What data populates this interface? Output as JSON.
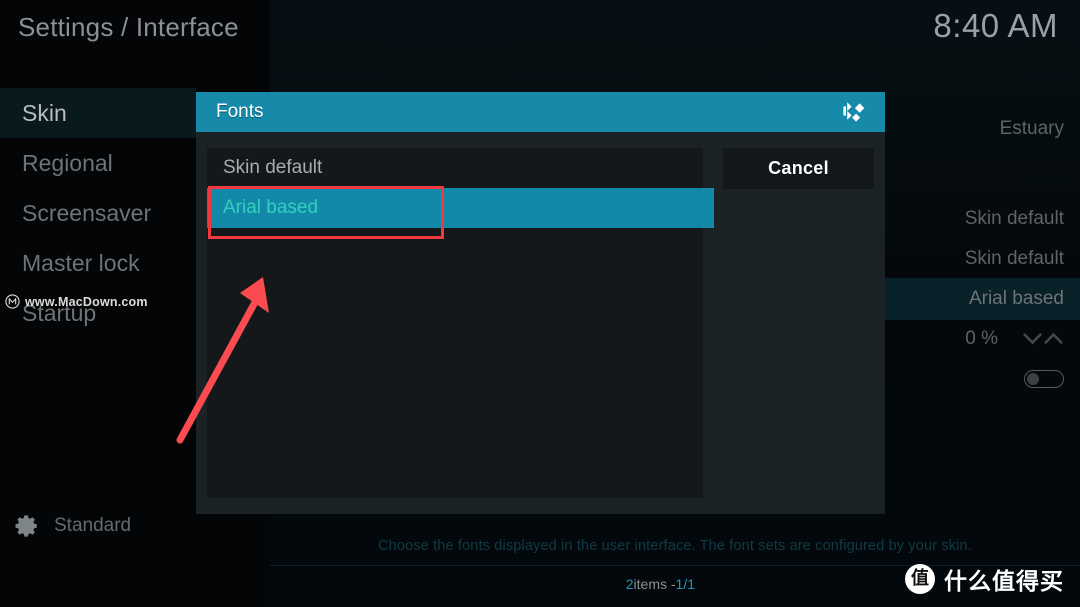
{
  "header": {
    "breadcrumb": "Settings / Interface",
    "clock": "8:40 AM"
  },
  "sidebar": {
    "items": [
      {
        "label": "Skin",
        "selected": true
      },
      {
        "label": "Regional",
        "selected": false
      },
      {
        "label": "Screensaver",
        "selected": false
      },
      {
        "label": "Master lock",
        "selected": false
      },
      {
        "label": "Startup",
        "selected": false
      }
    ],
    "level_button": {
      "label": "Standard",
      "icon": "gear-icon"
    }
  },
  "settings_panel": {
    "rows": [
      {
        "value": "Estuary",
        "type": "value",
        "highlighted": false
      },
      {
        "value": "Skin default",
        "type": "value",
        "highlighted": false
      },
      {
        "value": "Skin default",
        "type": "value",
        "highlighted": false
      },
      {
        "value": "Arial based",
        "type": "value",
        "highlighted": true
      },
      {
        "value": "0 %",
        "type": "spinner",
        "highlighted": false
      },
      {
        "value": "",
        "type": "toggle",
        "toggle_state": "off",
        "highlighted": false
      }
    ]
  },
  "dialog": {
    "title": "Fonts",
    "logo_icon": "kodi-logo-icon",
    "list": [
      {
        "label": "Skin default",
        "selected": false
      },
      {
        "label": "Arial based",
        "selected": true
      }
    ],
    "footer": {
      "count": "2",
      "separator": " items - ",
      "page": "1/1"
    },
    "cancel_label": "Cancel"
  },
  "help": {
    "text": "Choose the fonts displayed in the user interface. The font sets are configured by your skin."
  },
  "watermarks": {
    "macdown": "www.MacDown.com",
    "macdown_icon": "circled-m-icon",
    "smzdm_glyph": "值",
    "smzdm_text": "什么值得买"
  },
  "annotation": {
    "highlight_color": "#f2393f",
    "arrow_color": "#fa4b50"
  },
  "colors": {
    "accent_teal": "#1789a9",
    "selected_text": "#35cfbe",
    "dialog_chrome": "#1b2226",
    "list_bg": "#14181a"
  }
}
